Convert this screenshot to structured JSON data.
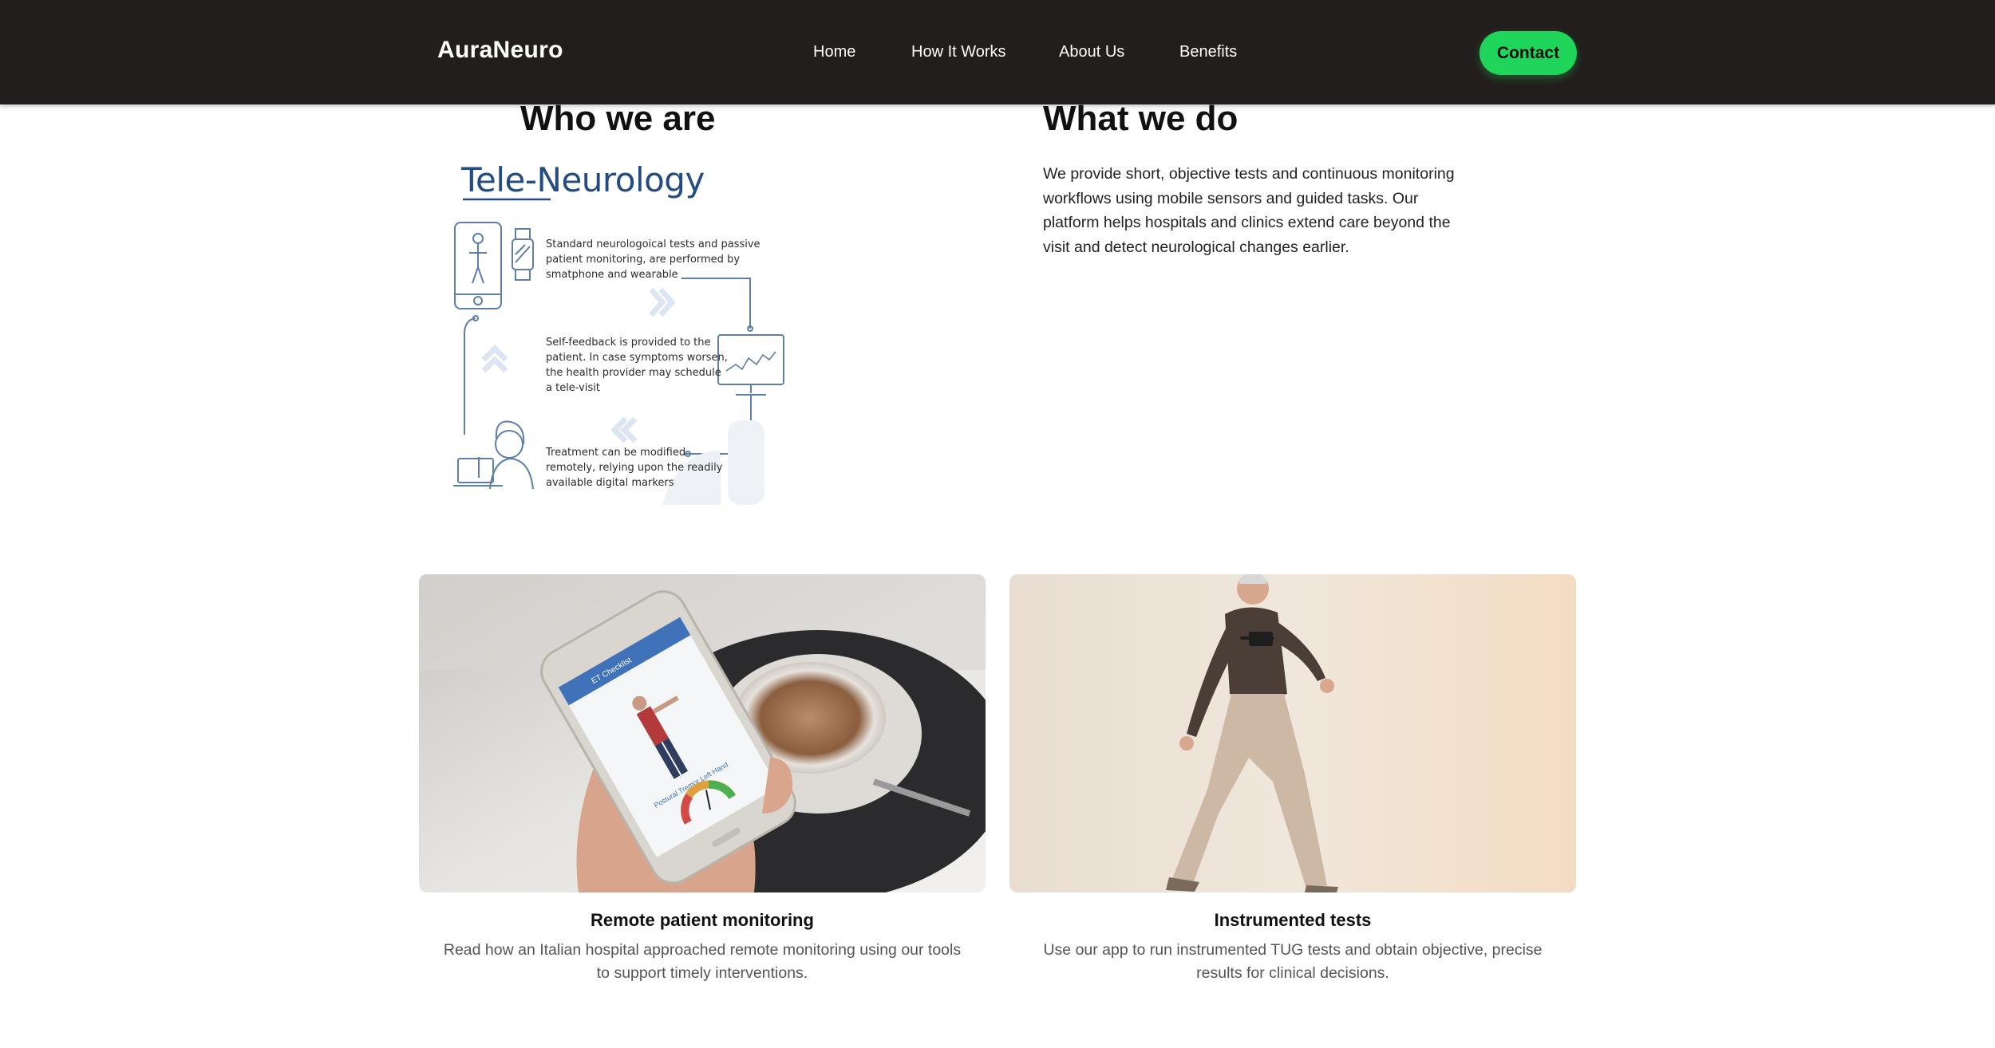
{
  "nav": {
    "brand": "AuraNeuro",
    "links": [
      {
        "label": "Home"
      },
      {
        "label": "How It Works"
      },
      {
        "label": "About Us"
      },
      {
        "label": "Benefits"
      }
    ],
    "contact_label": "Contact"
  },
  "who": {
    "heading": "Who we are",
    "illustration": {
      "title": "Tele-Neurology",
      "step1": "Standard neurologoical tests and passive\npatient monitoring, are  performed by\nsmatphone and wearable",
      "step2": "Self-feedback is provided to the\npatient. In case symptoms worsen,\nthe health provider may schedule\na tele-visit",
      "step3": "Treatment can be modified\nremotely, relying upon the readily\navailable digital markers"
    }
  },
  "what": {
    "heading": "What we do",
    "text": "We provide short, objective tests and continuous monitoring workflows using mobile sensors and guided tasks. Our platform helps hospitals and clinics extend care beyond the visit and detect neurological changes earlier."
  },
  "cards": [
    {
      "title": "Remote patient monitoring",
      "text": "Read how an Italian hospital approached remote monitoring using our tools to support timely interventions.",
      "phone_screen": {
        "header": "ET Checklist",
        "caption": "Postural Tremor Left Hand"
      }
    },
    {
      "title": "Instrumented tests",
      "text": "Use our app to run instrumented TUG tests and obtain objective, precise results for clinical decisions."
    }
  ],
  "colors": {
    "nav_bg": "#221e1d",
    "accent": "#1fd65a",
    "illustration_blue": "#244c84"
  }
}
